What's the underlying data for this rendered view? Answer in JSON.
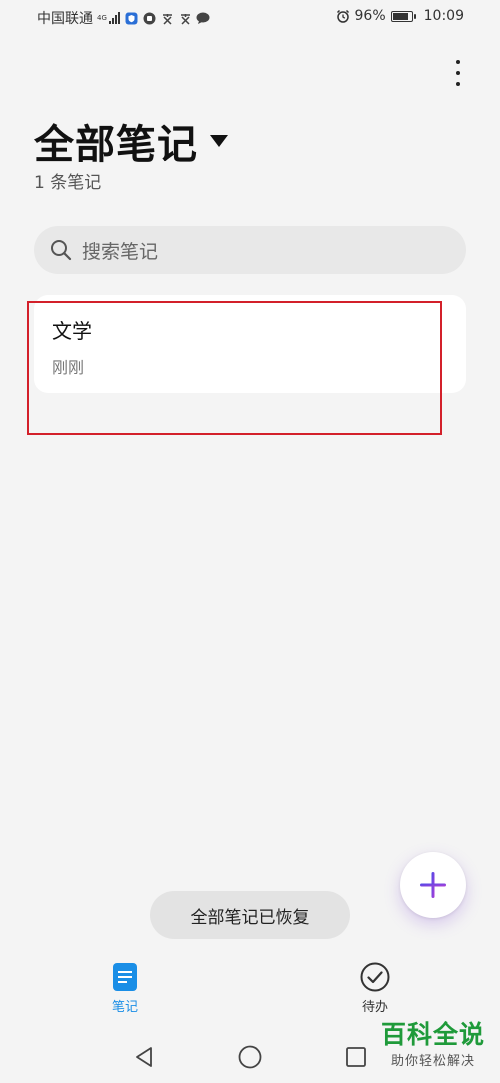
{
  "status_bar": {
    "carrier": "中国联通",
    "network": "4G",
    "battery": "96%",
    "battery_level": 0.96,
    "time": "10:09"
  },
  "header": {
    "title": "全部笔记",
    "note_count": "1 条笔记"
  },
  "search": {
    "placeholder": "搜索笔记"
  },
  "notes": [
    {
      "title": "文学",
      "time": "刚刚"
    }
  ],
  "toast": "全部笔记已恢复",
  "bottom_tabs": [
    {
      "label": "笔记",
      "active": true
    },
    {
      "label": "待办",
      "active": false
    }
  ],
  "watermark": {
    "main": "百科全说",
    "sub": "助你轻松解决"
  },
  "colors": {
    "accent": "#1a8ee6",
    "highlight": "#d3202a",
    "fab_plus": "#7a3fe0",
    "watermark": "#1f9a3a"
  }
}
